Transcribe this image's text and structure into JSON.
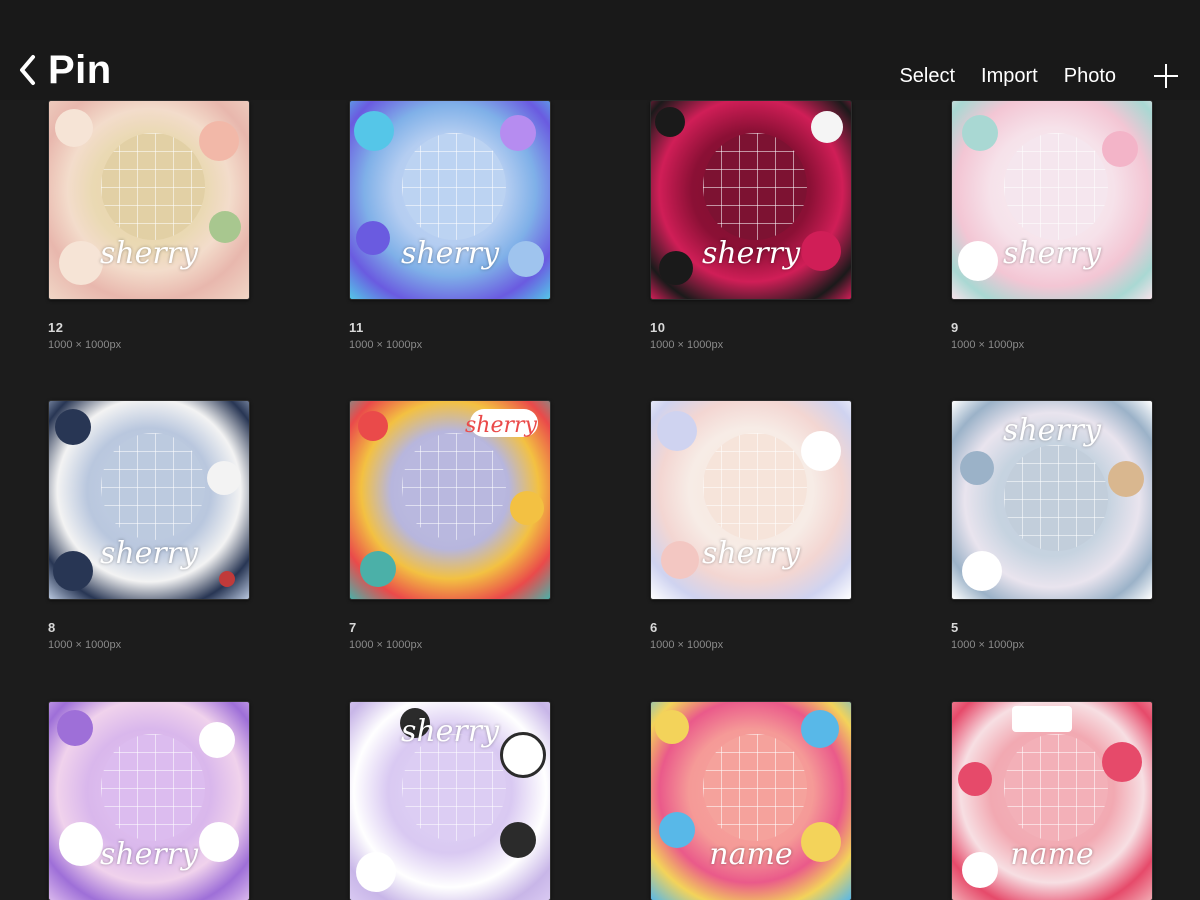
{
  "header": {
    "back_icon": "chevron-left-icon",
    "title": "Pin",
    "actions": {
      "select": "Select",
      "import": "Import",
      "photo": "Photo"
    },
    "add_icon": "plus-icon"
  },
  "artworks": [
    {
      "name": "12",
      "size": "1000 × 1000px",
      "signature": "sherry",
      "colors": [
        "#f3dccb",
        "#e8a8a0",
        "#c9a86a",
        "#a8c78f"
      ]
    },
    {
      "name": "11",
      "size": "1000 × 1000px",
      "signature": "sherry",
      "colors": [
        "#9fc4ee",
        "#6a5be0",
        "#55c6e8",
        "#b68cf0"
      ]
    },
    {
      "name": "10",
      "size": "1000 × 1000px",
      "signature": "sherry",
      "colors": [
        "#8b1035",
        "#d01e57",
        "#1a1a1a",
        "#f5f5f5"
      ]
    },
    {
      "name": "9",
      "size": "1000 × 1000px",
      "signature": "sherry",
      "colors": [
        "#f6e2ea",
        "#f3b4c8",
        "#a9d8d3",
        "#ffffff"
      ]
    },
    {
      "name": "8",
      "size": "1000 × 1000px",
      "signature": "sherry",
      "colors": [
        "#b9c7de",
        "#283654",
        "#f3f3f3",
        "#c03a3a"
      ]
    },
    {
      "name": "7",
      "size": "1000 × 1000px",
      "signature": "sherry",
      "colors": [
        "#b7b6dd",
        "#ea4a4a",
        "#f3c142",
        "#4bb0a8"
      ]
    },
    {
      "name": "6",
      "size": "1000 × 1000px",
      "signature": "sherry",
      "colors": [
        "#f7ece6",
        "#f3c7c2",
        "#cfd3f0",
        "#ffffff"
      ]
    },
    {
      "name": "5",
      "size": "1000 × 1000px",
      "signature": "sherry",
      "colors": [
        "#c6d3e0",
        "#e9e4ee",
        "#9bb2c8",
        "#ffffff"
      ]
    },
    {
      "name": "",
      "size": "",
      "signature": "sherry",
      "colors": [
        "#d9b7ec",
        "#9e6fd8",
        "#f0d2ec",
        "#ffffff"
      ]
    },
    {
      "name": "",
      "size": "",
      "signature": "sherry",
      "colors": [
        "#d9c9f2",
        "#2b2b2b",
        "#ffffff",
        "#c8b6e8"
      ]
    },
    {
      "name": "",
      "size": "",
      "signature": "name",
      "colors": [
        "#f59a97",
        "#f3d35a",
        "#58b8e8",
        "#ea5a8a"
      ]
    },
    {
      "name": "",
      "size": "",
      "signature": "name",
      "colors": [
        "#f2a9b2",
        "#e64a6a",
        "#f7dfe3",
        "#ffffff"
      ]
    }
  ]
}
